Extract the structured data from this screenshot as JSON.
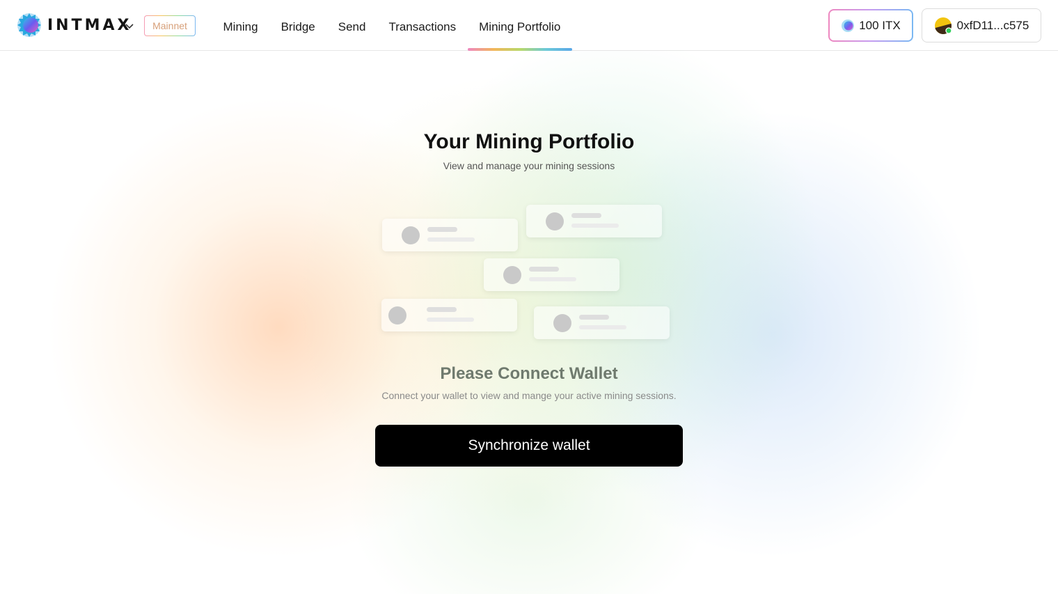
{
  "header": {
    "brand": "INTMAX",
    "network_badge": "Mainnet",
    "nav": [
      {
        "label": "Mining"
      },
      {
        "label": "Bridge"
      },
      {
        "label": "Send"
      },
      {
        "label": "Transactions"
      },
      {
        "label": "Mining Portfolio",
        "active": true
      }
    ],
    "balance_label": "100 ITX",
    "wallet_address": "0xfD11...c575"
  },
  "main": {
    "title": "Your Mining Portfolio",
    "subtitle": "View and manage your mining sessions",
    "connect_title": "Please Connect Wallet",
    "connect_subtitle": "Connect your wallet to view and mange your active mining sessions.",
    "sync_button": "Synchronize wallet"
  },
  "icons": {
    "logo": "intmax-logo-icon",
    "chevron": "chevron-down-icon",
    "token": "itx-token-icon",
    "wallet": "wallet-avatar-icon"
  },
  "colors": {
    "primary_button": "#000000",
    "connect_title": "#6f7a6e",
    "active_tab_gradient": [
      "#ee88c0",
      "#f2b65a",
      "#b9d86a",
      "#6cc9d8",
      "#5aa8e8"
    ]
  }
}
